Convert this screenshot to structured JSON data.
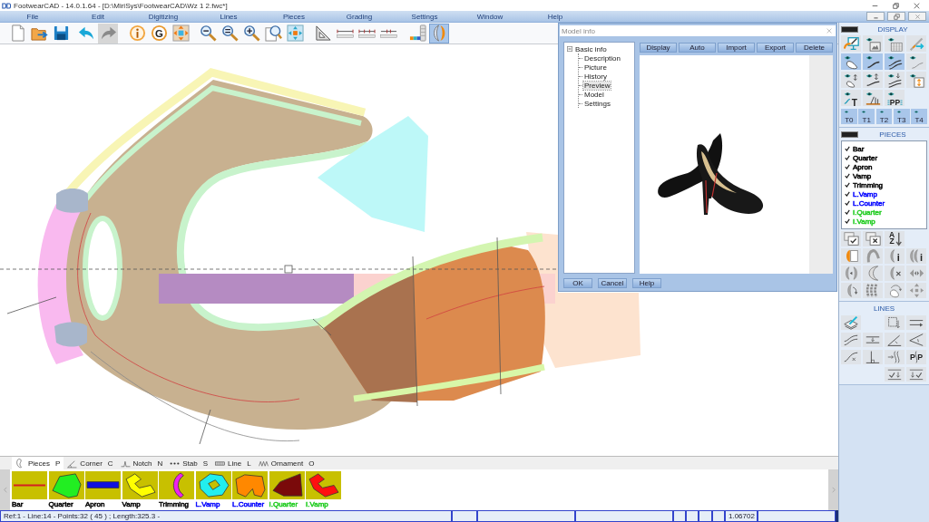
{
  "window": {
    "title": "FootwearCAD - 14.0.1.64 - [D:\\MiriSys\\FootwearCAD\\Wz 1 2.fwc*]"
  },
  "menu": [
    "File",
    "Edit",
    "Digitizing",
    "Lines",
    "Pieces",
    "Grading",
    "Settings",
    "Window",
    "Help"
  ],
  "toolbar": [
    {
      "kind": "new-page",
      "selected": false,
      "disabled": false
    },
    {
      "kind": "open-folder",
      "selected": false,
      "disabled": false
    },
    {
      "kind": "save",
      "selected": false,
      "disabled": false
    },
    {
      "kind": "undo",
      "selected": false,
      "disabled": false
    },
    {
      "kind": "redo",
      "selected": false,
      "disabled": true
    },
    {
      "kind": "info",
      "selected": false,
      "disabled": false
    },
    {
      "kind": "letter-circle",
      "glyph": "G",
      "selected": false,
      "disabled": false
    },
    {
      "kind": "move-arrows",
      "selected": false,
      "disabled": false
    },
    {
      "kind": "zoom-out",
      "selected": false,
      "disabled": false
    },
    {
      "kind": "zoom-equal",
      "selected": false,
      "disabled": false
    },
    {
      "kind": "zoom-in",
      "selected": false,
      "disabled": false
    },
    {
      "kind": "zoom-window",
      "selected": false,
      "disabled": false
    },
    {
      "kind": "fit-arrows",
      "selected": false,
      "disabled": false
    },
    {
      "kind": "set-square",
      "selected": false,
      "disabled": false
    },
    {
      "kind": "ruler-line",
      "selected": false,
      "disabled": false
    },
    {
      "kind": "ruler-ticks",
      "selected": false,
      "disabled": false
    },
    {
      "kind": "ruler-marks",
      "selected": false,
      "disabled": false
    },
    {
      "kind": "color-bars",
      "selected": false,
      "disabled": false
    },
    {
      "kind": "half-shapes",
      "selected": true,
      "disabled": false
    }
  ],
  "model_info": {
    "title": "Model info",
    "tree": {
      "label": "Basic info",
      "expanded": true,
      "selected": false,
      "children": [
        {
          "label": "Description",
          "selected": false
        },
        {
          "label": "Picture",
          "selected": false
        },
        {
          "label": "History",
          "selected": false
        },
        {
          "label": "Preview",
          "selected": true
        },
        {
          "label": "Model",
          "selected": false
        },
        {
          "label": "Settings",
          "selected": false
        }
      ]
    },
    "buttons": [
      "Display",
      "Auto",
      "Import",
      "Export",
      "Delete"
    ],
    "footer_buttons": [
      "OK",
      "Cancel",
      "Help"
    ]
  },
  "display_panel": {
    "title": "DISPLAY",
    "buttons": [
      {
        "kind": "edit-screen",
        "selected": false
      },
      {
        "kind": "eye-picture",
        "selected": false
      },
      {
        "kind": "eye-grid",
        "selected": false
      },
      {
        "kind": "arrow-line",
        "selected": false
      },
      {
        "kind": "eye-piece",
        "selected": true
      },
      {
        "kind": "eye-curve",
        "selected": true
      },
      {
        "kind": "eye-curves",
        "selected": true
      },
      {
        "kind": "eye-line",
        "selected": false
      },
      {
        "kind": "eye-piece-arrows",
        "selected": false
      },
      {
        "kind": "eye-curve-arrows",
        "selected": false
      },
      {
        "kind": "eye-curves-arrows",
        "selected": false
      },
      {
        "kind": "eye-box-arrows",
        "selected": false
      },
      {
        "kind": "eye-text",
        "glyph": "T",
        "selected": false
      },
      {
        "kind": "eye-ruler",
        "selected": false
      },
      {
        "kind": "eye-pp-lines",
        "glyph": "PP",
        "selected": false
      }
    ],
    "layer_buttons": [
      {
        "label": "T0",
        "selected": true
      },
      {
        "label": "T1",
        "selected": true
      },
      {
        "label": "T2",
        "selected": true
      },
      {
        "label": "T3",
        "selected": true
      },
      {
        "label": "T4",
        "selected": true
      }
    ]
  },
  "pieces_panel": {
    "title": "PIECES",
    "items": [
      {
        "label": "Bar",
        "checked": true,
        "color": "#000000"
      },
      {
        "label": "Quarter",
        "checked": true,
        "color": "#000000"
      },
      {
        "label": "Apron",
        "checked": true,
        "color": "#000000"
      },
      {
        "label": "Vamp",
        "checked": true,
        "color": "#000000"
      },
      {
        "label": "Trimming",
        "checked": true,
        "color": "#000000"
      },
      {
        "label": "L.Vamp",
        "checked": true,
        "color": "#0000ff"
      },
      {
        "label": "L.Counter",
        "checked": true,
        "color": "#0000ff"
      },
      {
        "label": "I.Quarter",
        "checked": true,
        "color": "#22cc22"
      },
      {
        "label": "I.Vamp",
        "checked": true,
        "color": "#22cc22"
      }
    ],
    "buttons": [
      {
        "kind": "copy-check"
      },
      {
        "kind": "copy-cross"
      },
      {
        "kind": "sort-az",
        "glyph": "AZ"
      },
      {
        "kind": "half-page"
      },
      {
        "kind": "hook-shape"
      },
      {
        "kind": "half-info",
        "glyph": "i"
      },
      {
        "kind": "halves-info",
        "glyph": "i"
      },
      {
        "kind": "halves-arrows"
      },
      {
        "kind": "half-outline"
      },
      {
        "kind": "half-cross"
      },
      {
        "kind": "mirror-arrows"
      },
      {
        "kind": "half-rotate"
      },
      {
        "kind": "stacked-arcs"
      },
      {
        "kind": "spin-shape"
      },
      {
        "kind": "scatter-arrows"
      }
    ]
  },
  "lines_panel": {
    "title": "LINES",
    "buttons": [
      {
        "kind": "pen-sheet"
      },
      {
        "kind": "box-arrow"
      },
      {
        "kind": "parallel-arrow"
      },
      {
        "kind": "parallel-curves"
      },
      {
        "kind": "line-midpoint"
      },
      {
        "kind": "angle-line"
      },
      {
        "kind": "angle-wedge"
      },
      {
        "kind": "curve-cross"
      },
      {
        "kind": "right-angle"
      },
      {
        "kind": "curve-arrows"
      },
      {
        "kind": "curve-letters",
        "glyph": "P P"
      },
      {
        "kind": "check-arrow"
      },
      {
        "kind": "arrow-check"
      }
    ]
  },
  "bottom_tabs": [
    {
      "kind": "piece-outline",
      "label": "Pieces",
      "key": "P",
      "selected": true
    },
    {
      "kind": "angle",
      "label": "Corner",
      "key": "C",
      "selected": false
    },
    {
      "kind": "notch",
      "label": "Notch",
      "key": "N",
      "selected": false
    },
    {
      "kind": "dots",
      "label": "Stab",
      "key": "S",
      "selected": false
    },
    {
      "kind": "band",
      "label": "Line",
      "key": "L",
      "selected": false
    },
    {
      "kind": "zigzag",
      "label": "Ornament",
      "key": "O",
      "selected": false
    }
  ],
  "piece_tiles": [
    {
      "label": "Bar",
      "color": "#000000",
      "thumbnail": {
        "kind": "line",
        "color": "#d42020"
      }
    },
    {
      "label": "Quarter",
      "color": "#000000",
      "thumbnail": {
        "kind": "quarter",
        "color": "#22ee22"
      }
    },
    {
      "label": "Apron",
      "color": "#000000",
      "thumbnail": {
        "kind": "band",
        "color": "#1010e0"
      }
    },
    {
      "label": "Vamp",
      "color": "#000000",
      "thumbnail": {
        "kind": "vamp",
        "color": "#ffff00"
      }
    },
    {
      "label": "Trimming",
      "color": "#000000",
      "thumbnail": {
        "kind": "arc",
        "color": "#ee22ee"
      }
    },
    {
      "label": "L.Vamp",
      "color": "#0000ff",
      "thumbnail": {
        "kind": "ring",
        "color": "#22eeee"
      }
    },
    {
      "label": "L.Counter",
      "color": "#0000ff",
      "thumbnail": {
        "kind": "counter",
        "color": "#ff8800"
      }
    },
    {
      "label": "I.Quarter",
      "color": "#22cc22",
      "thumbnail": {
        "kind": "wedge",
        "color": "#7a0a0a"
      }
    },
    {
      "label": "I.Vamp",
      "color": "#22cc22",
      "thumbnail": {
        "kind": "vamp",
        "color": "#ff1010"
      }
    }
  ],
  "status_bar": {
    "info": "Ref:1 - Line:14 - Points:32 ( 45 ) ; Length:325.3 -",
    "scale": "1.06702"
  }
}
